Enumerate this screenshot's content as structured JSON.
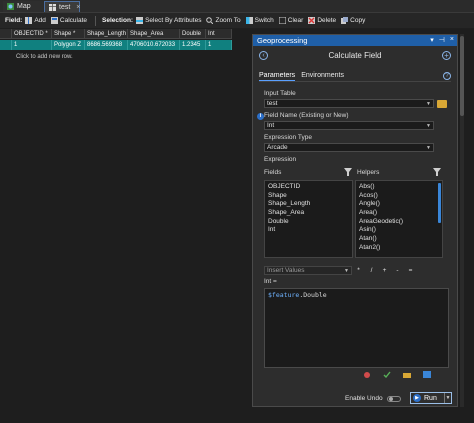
{
  "tabs": [
    {
      "label": "Map"
    },
    {
      "label": "test"
    }
  ],
  "toolbar": {
    "field_label": "Field:",
    "add": "Add",
    "calculate": "Calculate",
    "selection_label": "Selection:",
    "select_by_attributes": "Select By Attributes",
    "zoom_to": "Zoom To",
    "switch": "Switch",
    "clear": "Clear",
    "delete": "Delete",
    "copy": "Copy"
  },
  "table": {
    "columns": [
      "OBJECTID *",
      "Shape *",
      "Shape_Length",
      "Shape_Area",
      "Double",
      "Int"
    ],
    "rows": [
      [
        "1",
        "Polygon Z",
        "8686.569368",
        "4706010.672033",
        "1.2345",
        "1"
      ]
    ],
    "add_row_hint": "Click to add new row."
  },
  "geoprocessing": {
    "pane_title": "Geoprocessing",
    "tool_title": "Calculate Field",
    "tabs": [
      "Parameters",
      "Environments"
    ],
    "input_table_label": "Input Table",
    "input_table_value": "test",
    "field_name_label": "Field Name (Existing or New)",
    "field_name_value": "Int",
    "expression_type_label": "Expression Type",
    "expression_type_value": "Arcade",
    "expression_label": "Expression",
    "fields_label": "Fields",
    "helpers_label": "Helpers",
    "fields": [
      "OBJECTID",
      "Shape",
      "Shape_Length",
      "Shape_Area",
      "Double",
      "Int"
    ],
    "helpers": [
      "Abs()",
      "Acos()",
      "Angle()",
      "Area()",
      "AreaGeodetic()",
      "Asin()",
      "Atan()",
      "Atan2()"
    ],
    "insert_values_placeholder": "Insert Values",
    "operators": [
      "*",
      "/",
      "+",
      "-",
      "="
    ],
    "expression_target": "Int =",
    "expression_keyword": "$feature",
    "expression_property": ".Double",
    "enable_undo_label": "Enable Undo",
    "run_label": "Run"
  },
  "colors": {
    "selected_row": "#10807f",
    "pane_title_bar": "#1f5fa8",
    "accent": "#3a86d8"
  }
}
